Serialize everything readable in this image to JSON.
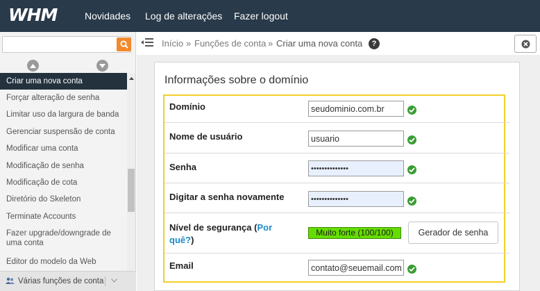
{
  "header": {
    "logo_text": "WHM",
    "nav": [
      {
        "label": "Novidades"
      },
      {
        "label": "Log de alterações"
      },
      {
        "label": "Fazer logout"
      }
    ]
  },
  "sidebar": {
    "search_placeholder": "",
    "items": [
      {
        "label": "Criar uma nova conta",
        "active": true
      },
      {
        "label": "Forçar alteração de senha"
      },
      {
        "label": "Limitar uso da largura de banda"
      },
      {
        "label": "Gerenciar suspensão de conta"
      },
      {
        "label": "Modificar uma conta"
      },
      {
        "label": "Modificação de senha"
      },
      {
        "label": "Modificação de cota"
      },
      {
        "label": "Diretório do Skeleton"
      },
      {
        "label": "Terminate Accounts"
      },
      {
        "label": "Fazer upgrade/downgrade de uma conta"
      },
      {
        "label": "Editor do modelo da Web"
      }
    ],
    "footer_label": "Várias funções de conta"
  },
  "breadcrumb": {
    "items": [
      "Início",
      "Funções de conta",
      "Criar uma nova conta"
    ],
    "separator": "»"
  },
  "form": {
    "title": "Informações sobre o domínio",
    "fields": {
      "domain": {
        "label": "Domínio",
        "value": "seudominio.com.br"
      },
      "username": {
        "label": "Nome de usuário",
        "value": "usuario"
      },
      "password": {
        "label": "Senha",
        "value": "••••••••••••••"
      },
      "password_confirm": {
        "label": "Digitar a senha novamente",
        "value": "••••••••••••••"
      },
      "strength": {
        "label": "Nível de segurança (",
        "link": "Por quê?",
        "label_end": ")",
        "value": "Muito forte (100/100)"
      },
      "email": {
        "label": "Email",
        "value": "contato@seuemail.com"
      }
    },
    "generate_button": "Gerador de senha"
  },
  "colors": {
    "topbar": "#293a4a",
    "active_menu": "#24323e",
    "search_button": "#f28a2d",
    "highlight_border": "#f2cf27",
    "strength_bar": "#66dd00",
    "check": "#3a9d34",
    "link": "#1a8ac9"
  }
}
